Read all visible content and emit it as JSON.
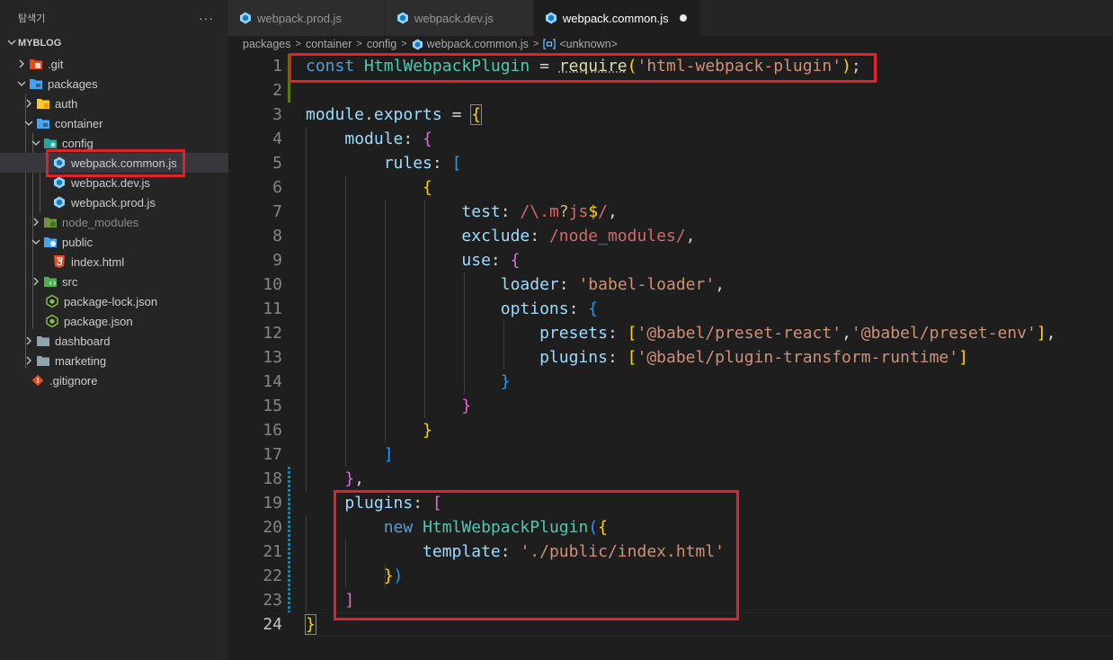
{
  "explorer": {
    "title": "탐색기",
    "more_label": "···",
    "root": "MYBLOG",
    "items": [
      {
        "label": ".git",
        "icon": "git-folder-icon"
      },
      {
        "label": "packages",
        "icon": "folder-icon"
      },
      {
        "label": "auth",
        "icon": "folder-icon"
      },
      {
        "label": "container",
        "icon": "folder-icon"
      },
      {
        "label": "config",
        "icon": "config-folder-icon"
      },
      {
        "label": "webpack.common.js",
        "icon": "webpack-icon"
      },
      {
        "label": "webpack.dev.js",
        "icon": "webpack-icon"
      },
      {
        "label": "webpack.prod.js",
        "icon": "webpack-icon"
      },
      {
        "label": "node_modules",
        "icon": "folder-icon"
      },
      {
        "label": "public",
        "icon": "folder-icon"
      },
      {
        "label": "index.html",
        "icon": "html5-icon"
      },
      {
        "label": "src",
        "icon": "src-folder-icon"
      },
      {
        "label": "package-lock.json",
        "icon": "nodejs-icon"
      },
      {
        "label": "package.json",
        "icon": "nodejs-icon"
      },
      {
        "label": "dashboard",
        "icon": "folder-icon"
      },
      {
        "label": "marketing",
        "icon": "folder-icon"
      },
      {
        "label": ".gitignore",
        "icon": "git-icon"
      }
    ]
  },
  "tabs": [
    {
      "label": "webpack.prod.js",
      "active": false
    },
    {
      "label": "webpack.dev.js",
      "active": false
    },
    {
      "label": "webpack.common.js",
      "active": true,
      "modified": true
    }
  ],
  "breadcrumb": [
    "packages",
    "container",
    "config",
    "webpack.common.js",
    "<unknown>"
  ],
  "editor": {
    "line_numbers": [
      "1",
      "2",
      "3",
      "4",
      "5",
      "6",
      "7",
      "8",
      "9",
      "10",
      "11",
      "12",
      "13",
      "14",
      "15",
      "16",
      "17",
      "18",
      "19",
      "20",
      "21",
      "22",
      "23",
      "24"
    ],
    "code": {
      "l1": {
        "k": "const",
        "cls": "HtmlWebpackPlugin",
        "eq": " = ",
        "fn": "require",
        "str": "'html-webpack-plugin'",
        "end": ";"
      },
      "l3": {
        "v": "module",
        "dot": ".",
        "p": "exports",
        "eq": " = "
      },
      "l4": {
        "p": "module",
        "c": ": "
      },
      "l5": {
        "p": "rules",
        "c": ": "
      },
      "l7": {
        "p": "test",
        "c": ": ",
        "rx1": "/\\.m",
        "rxq": "?",
        "rx2": "js",
        "rxd": "$",
        "rx3": "/",
        "cm": ","
      },
      "l8": {
        "p": "exclude",
        "c": ": ",
        "rx": "/node_modules/",
        "cm": ","
      },
      "l9": {
        "p": "use",
        "c": ": "
      },
      "l10": {
        "p": "loader",
        "c": ": ",
        "s": "'babel-loader'",
        "cm": ","
      },
      "l11": {
        "p": "options",
        "c": ": "
      },
      "l12": {
        "p": "presets",
        "c": ": ",
        "s1": "'@babel/preset-react'",
        "cm": ",",
        "s2": "'@babel/preset-env'",
        "end": ","
      },
      "l13": {
        "p": "plugins",
        "c": ": ",
        "s": "'@babel/plugin-transform-runtime'"
      },
      "l18": {
        "cm": ","
      },
      "l19": {
        "p": "plugins",
        "c": ": "
      },
      "l20": {
        "k": "new",
        "cls": "HtmlWebpackPlugin"
      },
      "l21": {
        "p": "template",
        "c": ": ",
        "s": "'./public/index.html'"
      }
    }
  },
  "colors": {
    "highlight_box": "#e0232a",
    "keyword": "#569cd6",
    "class": "#4ec9b0",
    "string": "#ce9178",
    "property": "#9cdcfe",
    "regex": "#d16969"
  }
}
